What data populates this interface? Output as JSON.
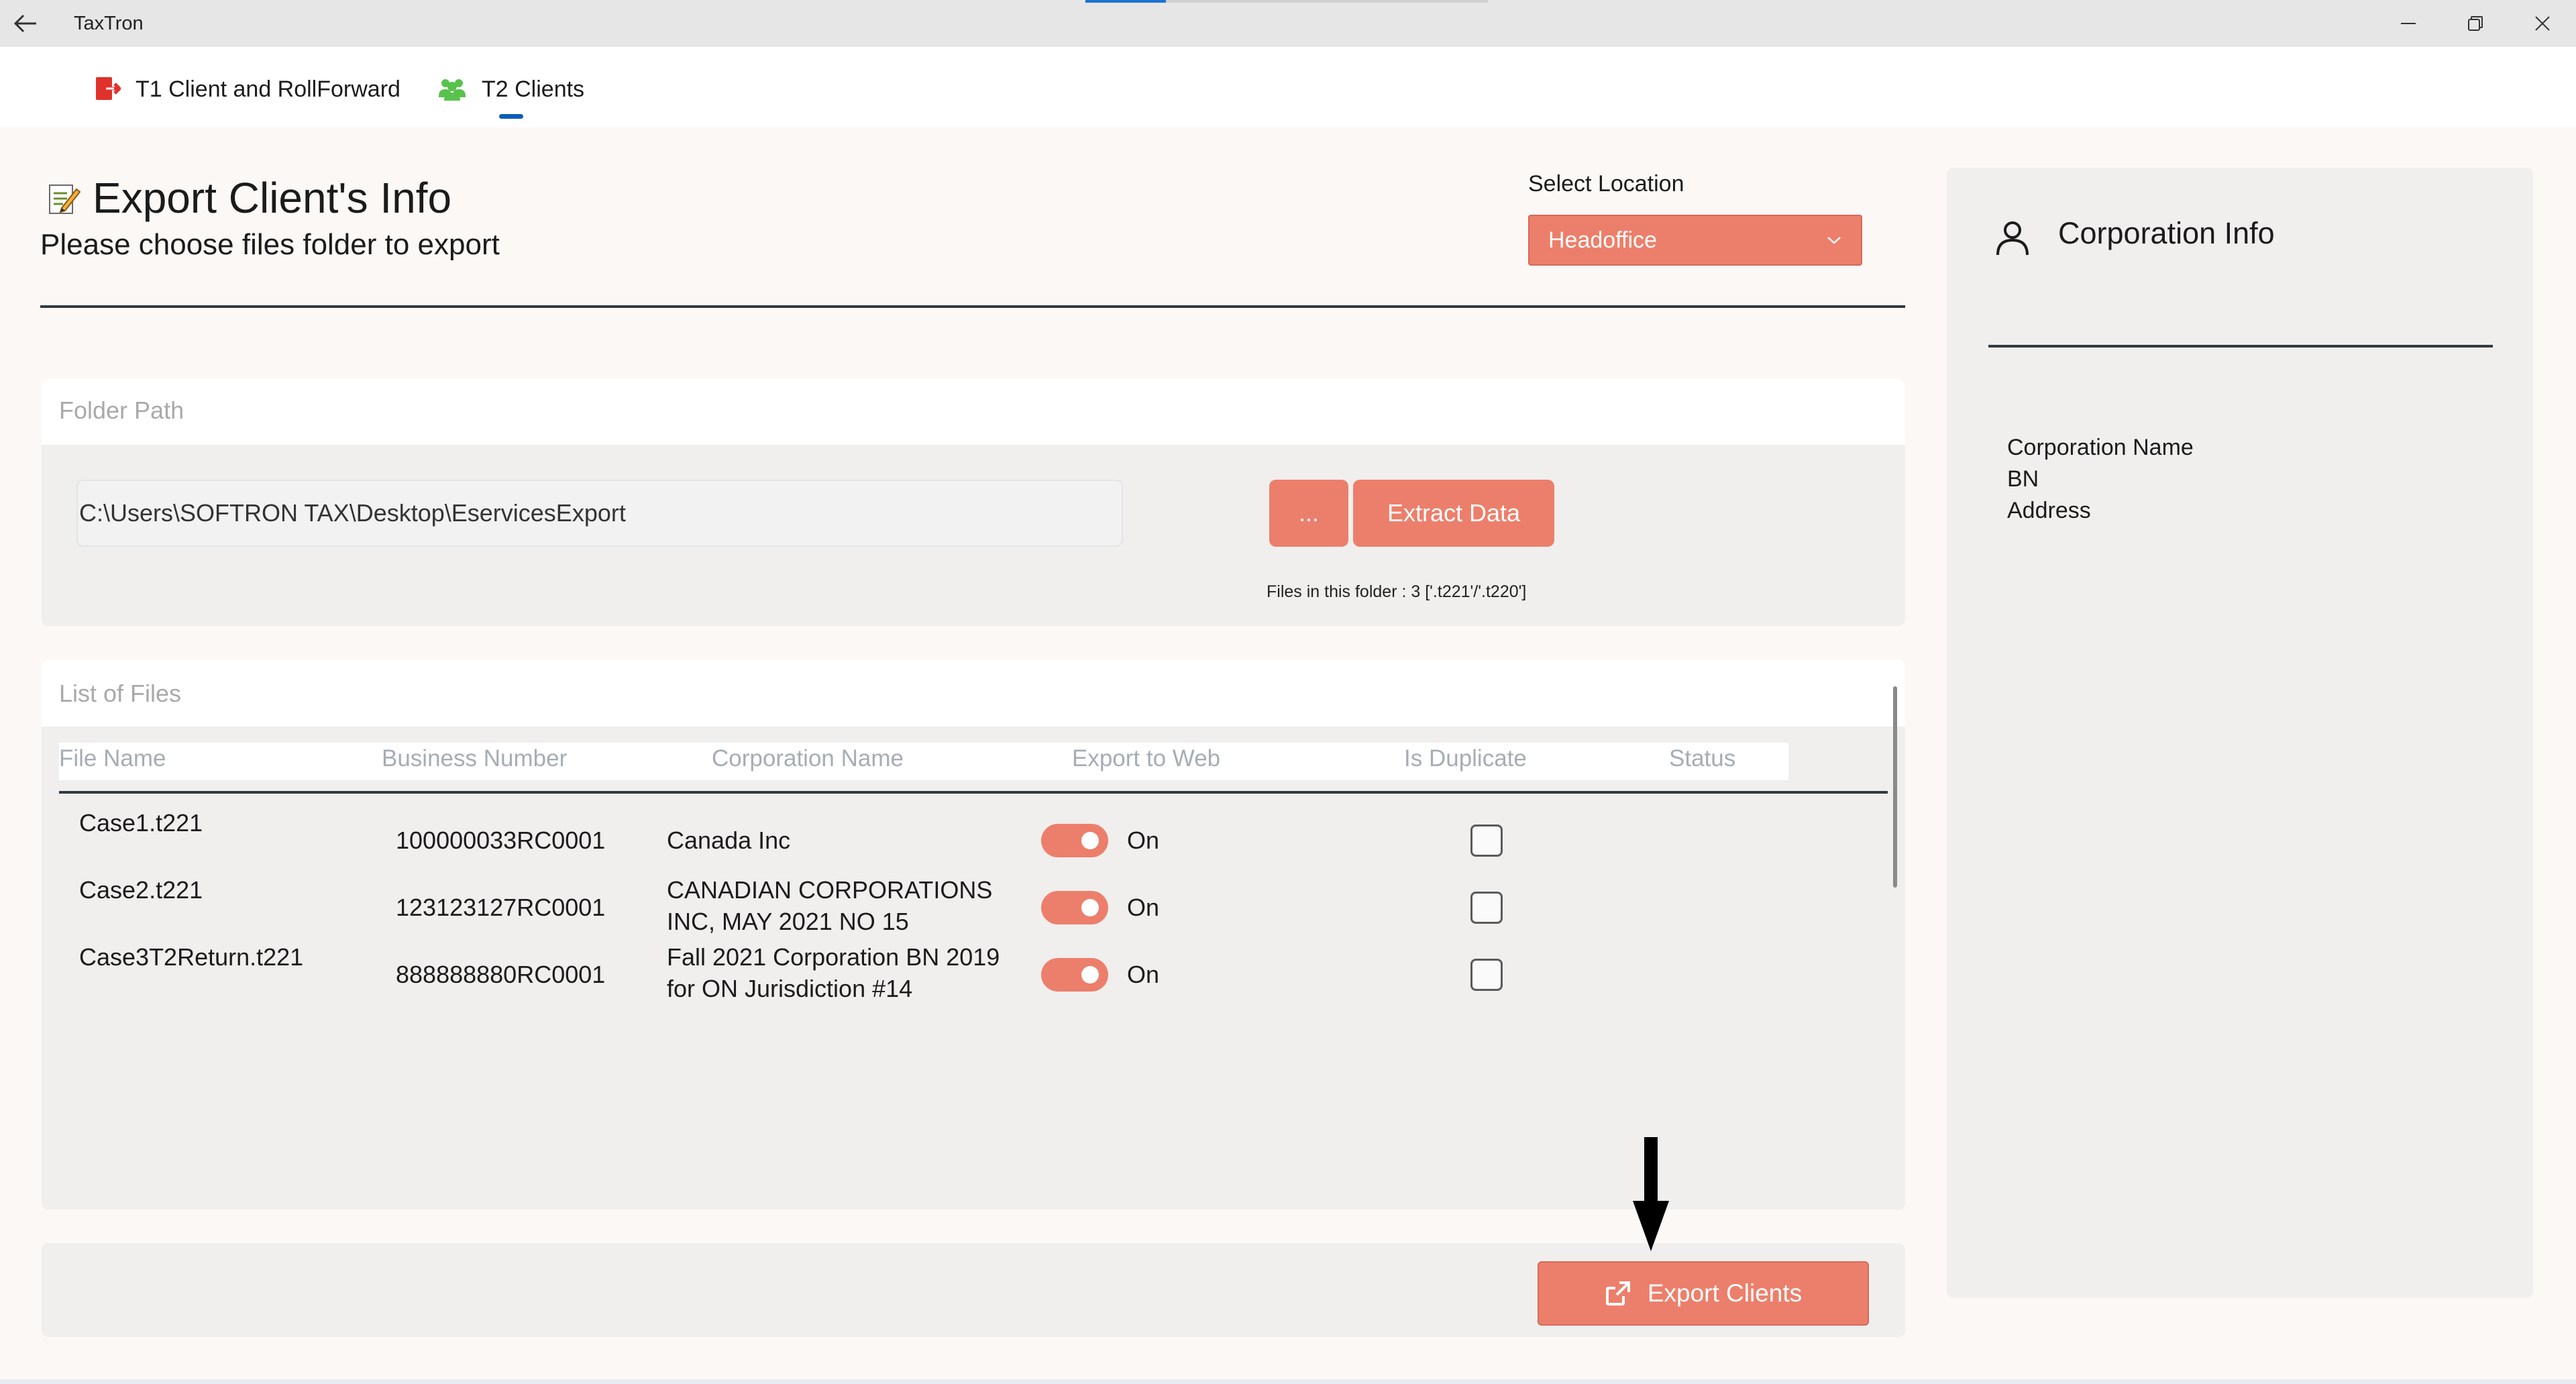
{
  "window": {
    "title": "TaxTron"
  },
  "tabs": [
    {
      "label": "T1 Client and RollForward",
      "icon": "t1-exit-icon",
      "icon_color": "#e0312b"
    },
    {
      "label": "T2 Clients",
      "icon": "users-icon",
      "icon_color": "#58c24d",
      "selected": true
    }
  ],
  "header": {
    "title": "Export Client's Info",
    "subtitle": "Please choose files folder to export",
    "location_label": "Select Location",
    "location_value": "Headoffice"
  },
  "folder": {
    "section_title": "Folder Path",
    "path": "C:\\Users\\SOFTRON TAX\\Desktop\\EservicesExport",
    "browse_label": "...",
    "extract_label": "Extract Data",
    "files_info": "Files in this folder : 3 ['.t221'/'.t220']"
  },
  "list": {
    "section_title": "List of Files",
    "columns": [
      "File Name",
      "Business Number",
      "Corporation Name",
      "Export to Web",
      "Is Duplicate",
      "Status"
    ],
    "rows": [
      {
        "file": "Case1.t221",
        "bn": "100000033RC0001",
        "corp": "Canada Inc",
        "export_state": "On",
        "export_on": true,
        "duplicate": false,
        "status": ""
      },
      {
        "file": "Case2.t221",
        "bn": "123123127RC0001",
        "corp": "CANADIAN CORPORATIONS INC, MAY 2021 NO 15",
        "export_state": "On",
        "export_on": true,
        "duplicate": false,
        "status": ""
      },
      {
        "file": "Case3T2Return.t221",
        "bn": "888888880RC0001",
        "corp": "Fall 2021 Corporation BN 2019 for ON Jurisdiction #14",
        "export_state": "On",
        "export_on": true,
        "duplicate": false,
        "status": ""
      }
    ]
  },
  "actions": {
    "export_label": "Export Clients"
  },
  "info_panel": {
    "title": "Corporation Info",
    "fields": [
      "Corporation Name",
      "BN",
      "Address"
    ]
  },
  "colors": {
    "accent": "#ec7f6b",
    "panel": "#f0efee",
    "background": "#fcf8f6"
  }
}
